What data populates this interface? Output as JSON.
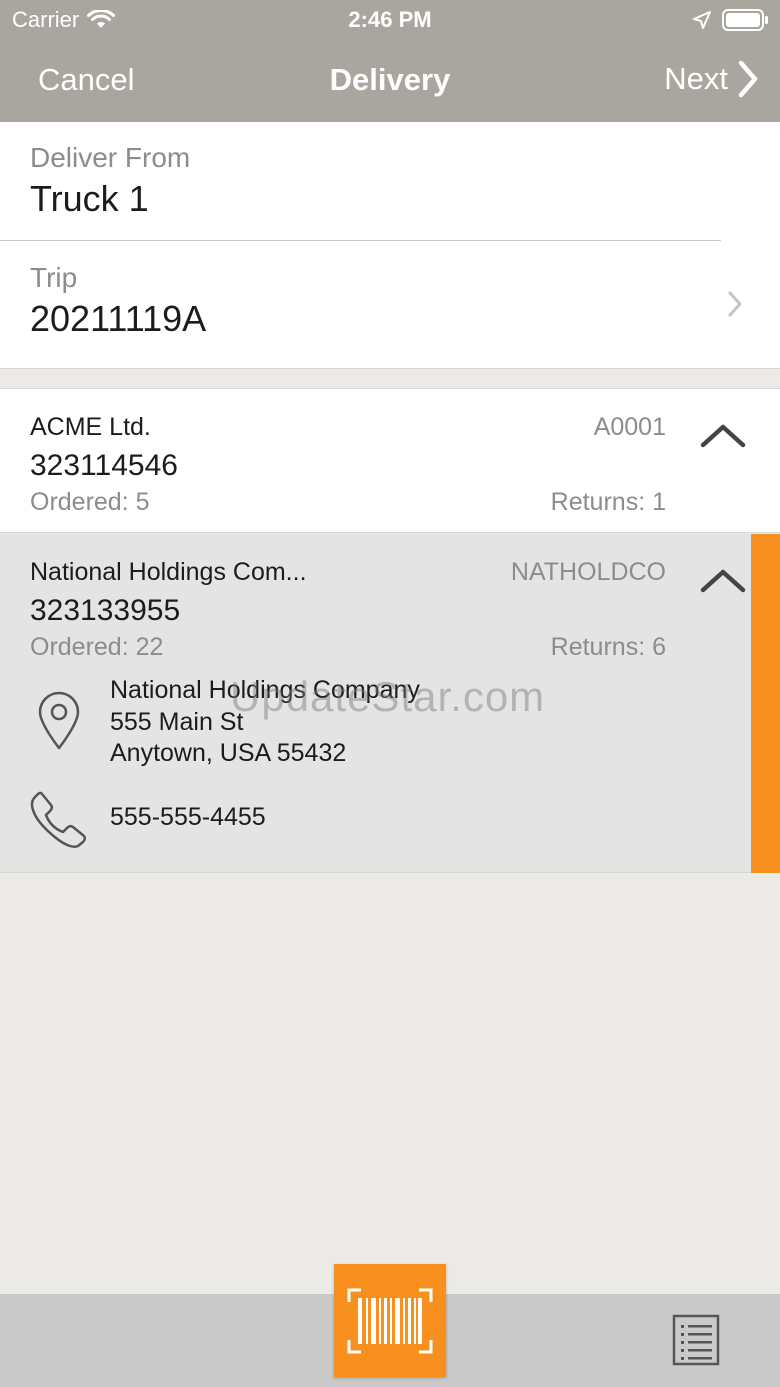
{
  "status_bar": {
    "carrier": "Carrier",
    "time": "2:46 PM"
  },
  "nav": {
    "cancel": "Cancel",
    "title": "Delivery",
    "next": "Next"
  },
  "deliver_from": {
    "label": "Deliver From",
    "value": "Truck 1"
  },
  "trip": {
    "label": "Trip",
    "value": "20211119A"
  },
  "customers": [
    {
      "name": "ACME Ltd.",
      "code": "A0001",
      "number": "323114546",
      "ordered": "Ordered: 5",
      "returns": "Returns: 1"
    },
    {
      "name": "National Holdings Com...",
      "code": "NATHOLDCO",
      "number": "323133955",
      "ordered": "Ordered: 22",
      "returns": "Returns: 6",
      "address": {
        "line1": "National Holdings Company",
        "line2": "555 Main St",
        "line3": "Anytown, USA 55432"
      },
      "phone": "555-555-4455"
    }
  ],
  "watermark": "UpdateStar.com",
  "icons": {
    "wifi": "wifi-icon",
    "location": "location-arrow-icon",
    "battery": "battery-icon",
    "next": "chevron-right-icon",
    "trip": "chevron-right-icon",
    "collapse": "chevron-up-icon",
    "address": "map-pin-icon",
    "phone": "phone-icon",
    "scan": "barcode-scan-icon",
    "list": "list-icon"
  },
  "colors": {
    "nav_bar": "#a9a69f",
    "accent": "#f7901e",
    "background": "#ebeae6",
    "selected_card": "#e4e4e4",
    "bottom_bar": "#c9c9c9"
  }
}
